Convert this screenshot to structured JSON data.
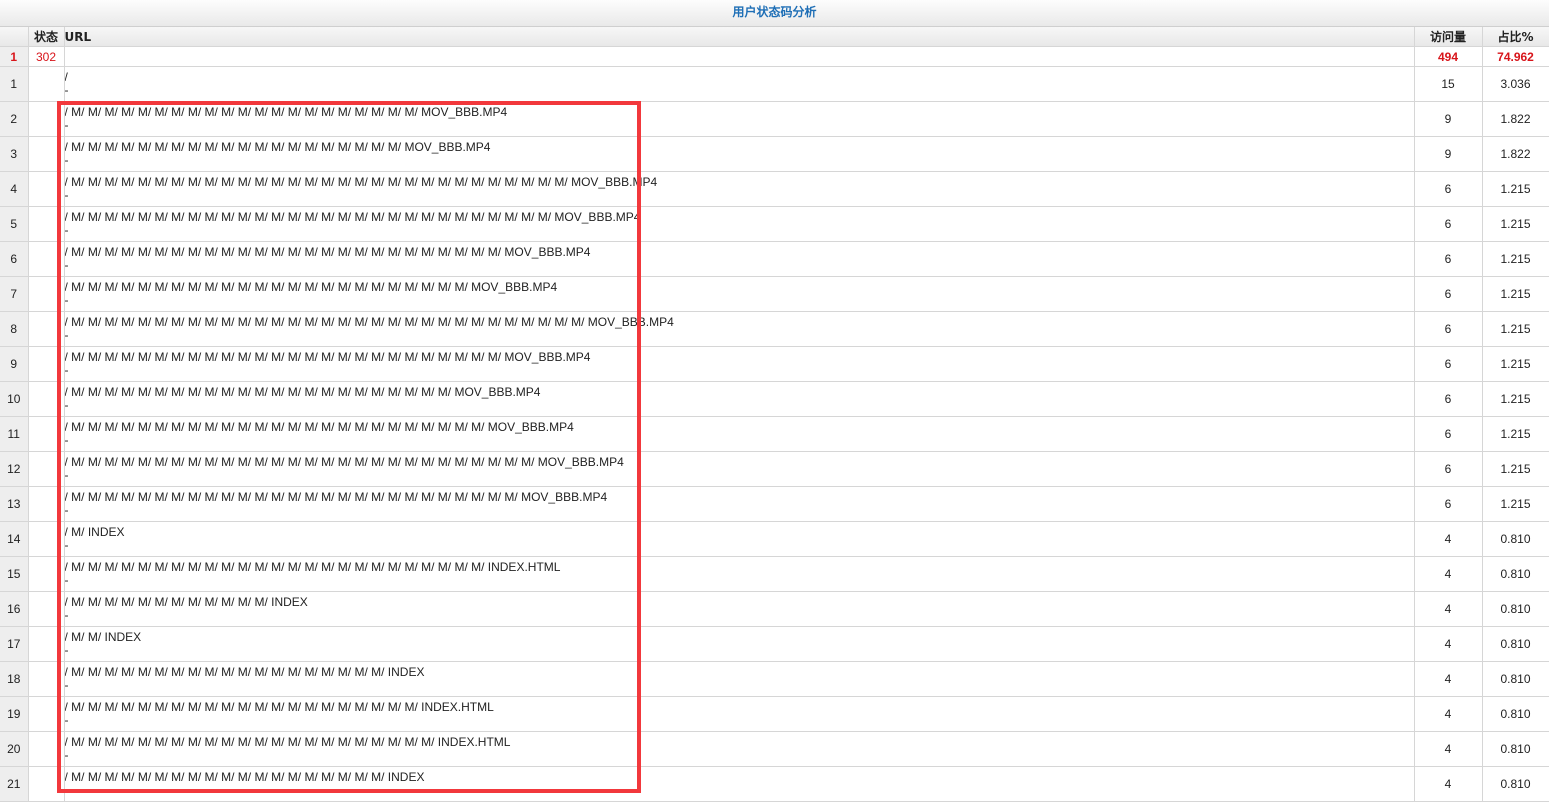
{
  "title": "用户状态码分析",
  "columns": {
    "status": "状态",
    "url": "URL",
    "visits": "访问量",
    "pct": "占比%"
  },
  "summary": {
    "index": "1",
    "status": "302",
    "url": "",
    "visits": "494",
    "pct": "74.962"
  },
  "rows": [
    {
      "index": "1",
      "url": "/",
      "ref": "-",
      "visits": "15",
      "pct": "3.036"
    },
    {
      "index": "2",
      "url": "/ M/ M/ M/ M/ M/ M/ M/ M/ M/ M/ M/ M/ M/ M/ M/ M/ M/ M/ M/ M/ M/ MOV_BBB.MP4",
      "ref": "-",
      "visits": "9",
      "pct": "1.822"
    },
    {
      "index": "3",
      "url": "/ M/ M/ M/ M/ M/ M/ M/ M/ M/ M/ M/ M/ M/ M/ M/ M/ M/ M/ M/ M/ MOV_BBB.MP4",
      "ref": "-",
      "visits": "9",
      "pct": "1.822"
    },
    {
      "index": "4",
      "url": "/ M/ M/ M/ M/ M/ M/ M/ M/ M/ M/ M/ M/ M/ M/ M/ M/ M/ M/ M/ M/ M/ M/ M/ M/ M/ M/ M/ M/ M/ M/ MOV_BBB.MP4",
      "ref": "-",
      "visits": "6",
      "pct": "1.215"
    },
    {
      "index": "5",
      "url": "/ M/ M/ M/ M/ M/ M/ M/ M/ M/ M/ M/ M/ M/ M/ M/ M/ M/ M/ M/ M/ M/ M/ M/ M/ M/ M/ M/ M/ M/ MOV_BBB.MP4",
      "ref": "-",
      "visits": "6",
      "pct": "1.215"
    },
    {
      "index": "6",
      "url": "/ M/ M/ M/ M/ M/ M/ M/ M/ M/ M/ M/ M/ M/ M/ M/ M/ M/ M/ M/ M/ M/ M/ M/ M/ M/ M/ MOV_BBB.MP4",
      "ref": "-",
      "visits": "6",
      "pct": "1.215"
    },
    {
      "index": "7",
      "url": "/ M/ M/ M/ M/ M/ M/ M/ M/ M/ M/ M/ M/ M/ M/ M/ M/ M/ M/ M/ M/ M/ M/ M/ M/ MOV_BBB.MP4",
      "ref": "-",
      "visits": "6",
      "pct": "1.215"
    },
    {
      "index": "8",
      "url": "/ M/ M/ M/ M/ M/ M/ M/ M/ M/ M/ M/ M/ M/ M/ M/ M/ M/ M/ M/ M/ M/ M/ M/ M/ M/ M/ M/ M/ M/ M/ M/ MOV_BBB.MP4",
      "ref": "-",
      "visits": "6",
      "pct": "1.215"
    },
    {
      "index": "9",
      "url": "/ M/ M/ M/ M/ M/ M/ M/ M/ M/ M/ M/ M/ M/ M/ M/ M/ M/ M/ M/ M/ M/ M/ M/ M/ M/ M/ MOV_BBB.MP4",
      "ref": "-",
      "visits": "6",
      "pct": "1.215"
    },
    {
      "index": "10",
      "url": "/ M/ M/ M/ M/ M/ M/ M/ M/ M/ M/ M/ M/ M/ M/ M/ M/ M/ M/ M/ M/ M/ M/ M/ MOV_BBB.MP4",
      "ref": "-",
      "visits": "6",
      "pct": "1.215"
    },
    {
      "index": "11",
      "url": "/ M/ M/ M/ M/ M/ M/ M/ M/ M/ M/ M/ M/ M/ M/ M/ M/ M/ M/ M/ M/ M/ M/ M/ M/ M/ MOV_BBB.MP4",
      "ref": "-",
      "visits": "6",
      "pct": "1.215"
    },
    {
      "index": "12",
      "url": "/ M/ M/ M/ M/ M/ M/ M/ M/ M/ M/ M/ M/ M/ M/ M/ M/ M/ M/ M/ M/ M/ M/ M/ M/ M/ M/ M/ M/ MOV_BBB.MP4",
      "ref": "-",
      "visits": "6",
      "pct": "1.215"
    },
    {
      "index": "13",
      "url": "/ M/ M/ M/ M/ M/ M/ M/ M/ M/ M/ M/ M/ M/ M/ M/ M/ M/ M/ M/ M/ M/ M/ M/ M/ M/ M/ M/ MOV_BBB.MP4",
      "ref": "-",
      "visits": "6",
      "pct": "1.215"
    },
    {
      "index": "14",
      "url": "/ M/ INDEX",
      "ref": "-",
      "visits": "4",
      "pct": "0.810"
    },
    {
      "index": "15",
      "url": "/ M/ M/ M/ M/ M/ M/ M/ M/ M/ M/ M/ M/ M/ M/ M/ M/ M/ M/ M/ M/ M/ M/ M/ M/ M/ INDEX.HTML",
      "ref": "-",
      "visits": "4",
      "pct": "0.810"
    },
    {
      "index": "16",
      "url": "/ M/ M/ M/ M/ M/ M/ M/ M/ M/ M/ M/ M/ INDEX",
      "ref": "-",
      "visits": "4",
      "pct": "0.810"
    },
    {
      "index": "17",
      "url": "/ M/ M/ INDEX",
      "ref": "-",
      "visits": "4",
      "pct": "0.810"
    },
    {
      "index": "18",
      "url": "/ M/ M/ M/ M/ M/ M/ M/ M/ M/ M/ M/ M/ M/ M/ M/ M/ M/ M/ M/ INDEX",
      "ref": "-",
      "visits": "4",
      "pct": "0.810"
    },
    {
      "index": "19",
      "url": "/ M/ M/ M/ M/ M/ M/ M/ M/ M/ M/ M/ M/ M/ M/ M/ M/ M/ M/ M/ M/ M/ INDEX.HTML",
      "ref": "-",
      "visits": "4",
      "pct": "0.810"
    },
    {
      "index": "20",
      "url": "/ M/ M/ M/ M/ M/ M/ M/ M/ M/ M/ M/ M/ M/ M/ M/ M/ M/ M/ M/ M/ M/ M/ INDEX.HTML",
      "ref": "-",
      "visits": "4",
      "pct": "0.810"
    },
    {
      "index": "21",
      "url": "/ M/ M/ M/ M/ M/ M/ M/ M/ M/ M/ M/ M/ M/ M/ M/ M/ M/ M/ M/ INDEX",
      "ref": "-",
      "visits": "4",
      "pct": "0.810"
    }
  ],
  "colors": {
    "title": "#1f6fb6",
    "summary": "#d8141a",
    "highlight": "#f2383c"
  }
}
